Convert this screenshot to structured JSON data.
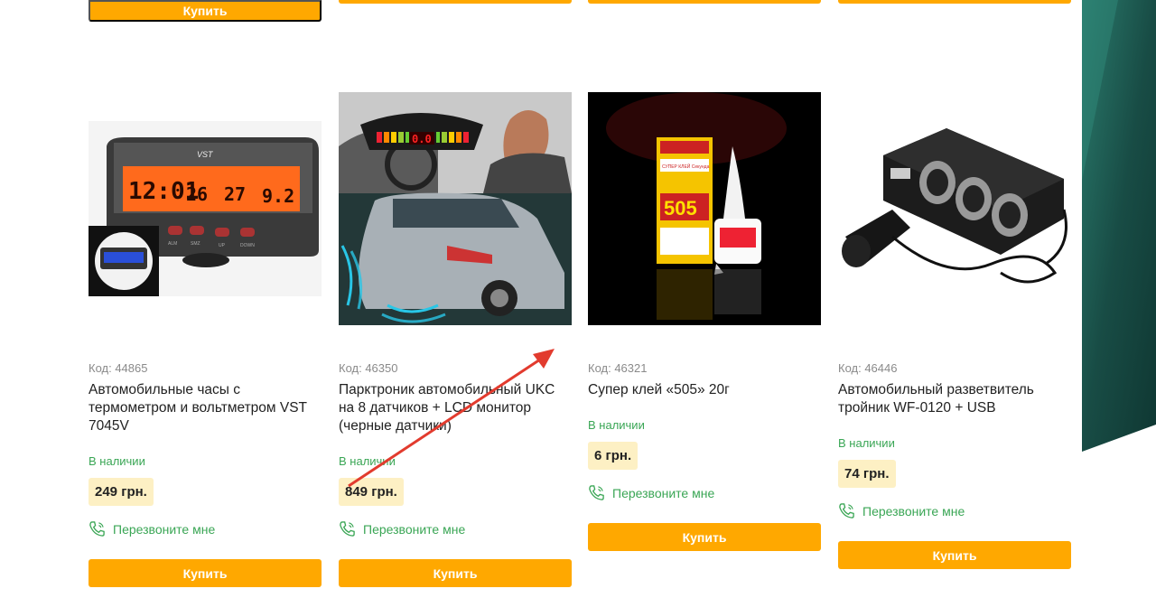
{
  "colors": {
    "accent": "#ffa800",
    "in_stock": "#3aa655",
    "price_bg": "#fdf0c4",
    "annotation": "#e23b2e",
    "teal": "#1c5a52"
  },
  "top_buttons": [
    {
      "label": "Купить"
    },
    {
      "label": ""
    },
    {
      "label": ""
    },
    {
      "label": ""
    }
  ],
  "products": [
    {
      "code": "Код: 44865",
      "title": "Автомобильные часы с термометром и вольтметром VST 7045V",
      "stock": "В наличии",
      "price": "249 грн.",
      "callback": "Перезвоните мне",
      "buy": "Купить",
      "image": {
        "brand": "VST",
        "time": "12:01",
        "temp_in": "26",
        "temp_out": "27",
        "volt": "9.2",
        "button_labels": [
          "ALM",
          "SMZ",
          "UP",
          "DOWN"
        ]
      }
    },
    {
      "code": "Код: 46350",
      "title": "Парктроник автомобильный UKC на 8 датчиков + LCD монитор (черные датчики)",
      "stock": "В наличии",
      "price": "849 грн.",
      "callback": "Перезвоните мне",
      "buy": "Купить",
      "image": {
        "display": "0.0"
      }
    },
    {
      "code": "Код: 46321",
      "title": "Супер клей «505» 20г",
      "stock": "В наличии",
      "price": "6 грн.",
      "callback": "Перезвоните мне",
      "buy": "Купить",
      "image": {
        "big": "505",
        "brand": "СУПЕР КЛЕЙ Секунда"
      }
    },
    {
      "code": "Код: 46446",
      "title": "Автомобильный разветвитель тройник WF-0120 + USB",
      "stock": "В наличии",
      "price": "74 грн.",
      "callback": "Перезвоните мне",
      "buy": "Купить",
      "image": {}
    }
  ]
}
